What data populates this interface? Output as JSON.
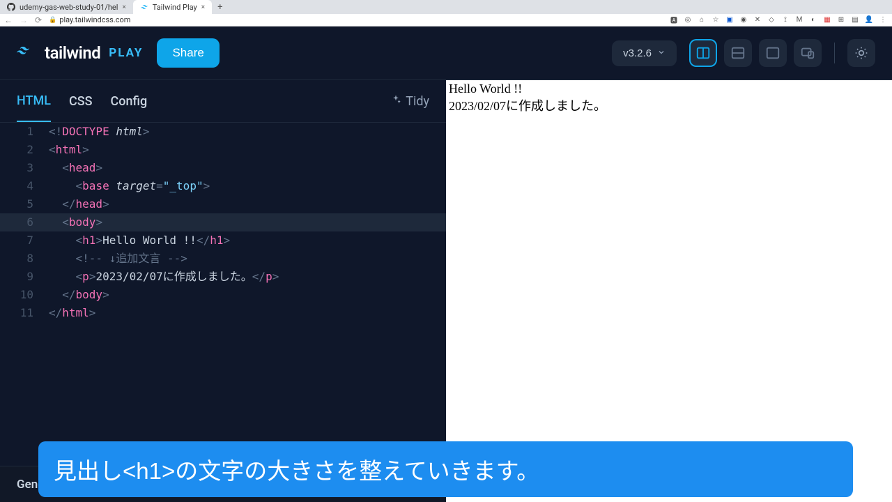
{
  "browser": {
    "tabs": [
      {
        "title": "udemy-gas-web-study-01/hel",
        "icon": "github"
      },
      {
        "title": "Tailwind Play",
        "icon": "tailwind"
      }
    ],
    "url_host": "play.tailwindcss.com",
    "lock": "🔒"
  },
  "header": {
    "brand": "tailwind",
    "play": "PLAY",
    "share": "Share",
    "version": "v3.2.6"
  },
  "tabs": {
    "html": "HTML",
    "css": "CSS",
    "config": "Config",
    "tidy": "Tidy"
  },
  "code": {
    "lines": [
      {
        "n": "1",
        "html": "<span class='tok-bracket'>&lt;!</span><span class='tok-tag'>DOCTYPE</span> <span class='tok-attr'>html</span><span class='tok-bracket'>&gt;</span>"
      },
      {
        "n": "2",
        "html": "<span class='tok-bracket'>&lt;</span><span class='tok-tag'>html</span><span class='tok-bracket'>&gt;</span>"
      },
      {
        "n": "3",
        "html": "  <span class='tok-bracket'>&lt;</span><span class='tok-tag'>head</span><span class='tok-bracket'>&gt;</span>"
      },
      {
        "n": "4",
        "html": "    <span class='tok-bracket'>&lt;</span><span class='tok-tag'>base</span> <span class='tok-attr'>target</span><span class='tok-bracket'>=</span><span class='tok-str'>\"_top\"</span><span class='tok-bracket'>&gt;</span>"
      },
      {
        "n": "5",
        "html": "  <span class='tok-bracket'>&lt;/</span><span class='tok-tag'>head</span><span class='tok-bracket'>&gt;</span>"
      },
      {
        "n": "6",
        "html": "  <span class='tok-bracket'>&lt;</span><span class='tok-tag'>body</span><span class='tok-bracket'>&gt;</span>",
        "hl": true
      },
      {
        "n": "7",
        "html": "    <span class='tok-bracket'>&lt;</span><span class='tok-tag'>h1</span><span class='tok-bracket'>&gt;</span><span class='tok-text'>Hello World !!</span><span class='tok-bracket'>&lt;/</span><span class='tok-tag'>h1</span><span class='tok-bracket'>&gt;</span>"
      },
      {
        "n": "8",
        "html": "    <span class='tok-comment'>&lt;!-- ↓追加文言 --&gt;</span>"
      },
      {
        "n": "9",
        "html": "    <span class='tok-bracket'>&lt;</span><span class='tok-tag'>p</span><span class='tok-bracket'>&gt;</span><span class='tok-text'>2023/02/07に作成しました。</span><span class='tok-bracket'>&lt;/</span><span class='tok-tag'>p</span><span class='tok-bracket'>&gt;</span>"
      },
      {
        "n": "10",
        "html": "  <span class='tok-bracket'>&lt;/</span><span class='tok-tag'>body</span><span class='tok-bracket'>&gt;</span>"
      },
      {
        "n": "11",
        "html": "<span class='tok-bracket'>&lt;/</span><span class='tok-tag'>html</span><span class='tok-bracket'>&gt;</span>"
      }
    ]
  },
  "preview": {
    "h1": "Hello World !!",
    "p": "2023/02/07に作成しました。"
  },
  "generated_css": "Generated CSS",
  "caption": "見出し<h1>の文字の大きさを整えていきます。"
}
